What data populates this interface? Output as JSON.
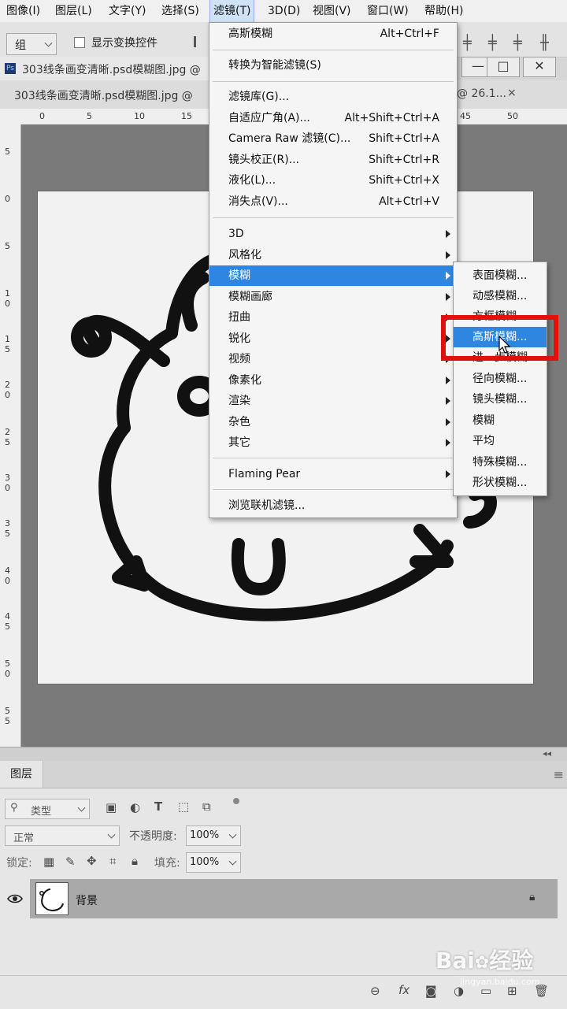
{
  "menubar": {
    "items": [
      "图像(I)",
      "图层(L)",
      "文字(Y)",
      "选择(S)",
      "滤镜(T)",
      "3D(D)",
      "视图(V)",
      "窗口(W)",
      "帮助(H)"
    ]
  },
  "options_bar": {
    "group_select": "组",
    "show_transform_label": "显示变换控件"
  },
  "doc_tabs": {
    "tab1": "303线条画变清晰.psd模糊图.jpg @",
    "tab2": "303线条画变清晰.psd模糊图.jpg @",
    "tab_right": "@ 26.1...",
    "close": "×"
  },
  "window_buttons": [
    "—",
    "□",
    "✕"
  ],
  "rulers": {
    "top": [
      "0",
      "5",
      "10",
      "15",
      "45",
      "50"
    ],
    "left": [
      "5",
      "0",
      "5",
      "1 0",
      "1 5",
      "2 0",
      "2 5",
      "3 0",
      "3 5",
      "4 0",
      "4 5",
      "5 0",
      "5 5"
    ]
  },
  "filter_menu": {
    "items": [
      {
        "label": "高斯模糊",
        "shortcut": "Alt+Ctrl+F"
      },
      {
        "label": "转换为智能滤镜(S)",
        "shortcut": ""
      },
      {
        "label": "滤镜库(G)...",
        "shortcut": ""
      },
      {
        "label": "自适应广角(A)...",
        "shortcut": "Alt+Shift+Ctrl+A"
      },
      {
        "label": "Camera Raw 滤镜(C)...",
        "shortcut": "Shift+Ctrl+A"
      },
      {
        "label": "镜头校正(R)...",
        "shortcut": "Shift+Ctrl+R"
      },
      {
        "label": "液化(L)...",
        "shortcut": "Shift+Ctrl+X"
      },
      {
        "label": "消失点(V)...",
        "shortcut": "Alt+Ctrl+V"
      },
      {
        "label": "3D"
      },
      {
        "label": "风格化"
      },
      {
        "label": "模糊"
      },
      {
        "label": "模糊画廊"
      },
      {
        "label": "扭曲"
      },
      {
        "label": "锐化"
      },
      {
        "label": "视频"
      },
      {
        "label": "像素化"
      },
      {
        "label": "渲染"
      },
      {
        "label": "杂色"
      },
      {
        "label": "其它"
      },
      {
        "label": "Flaming Pear"
      },
      {
        "label": "浏览联机滤镜..."
      }
    ]
  },
  "blur_submenu": {
    "items": [
      "表面模糊...",
      "动感模糊...",
      "方框模糊...",
      "高斯模糊...",
      "进一步模糊",
      "径向模糊...",
      "镜头模糊...",
      "模糊",
      "平均",
      "特殊模糊...",
      "形状模糊..."
    ]
  },
  "layers_panel": {
    "tab": "图层",
    "filter_kind": "类型",
    "blend_mode": "正常",
    "opacity_label": "不透明度:",
    "opacity_value": "100%",
    "lock_label": "锁定:",
    "fill_label": "填充:",
    "fill_value": "100%",
    "layer_name": "背景"
  },
  "watermark": {
    "text": "Bai",
    "text2": "经验",
    "sub": "jingyan.baidu.com"
  },
  "colors": {
    "highlight": "#2f86e0",
    "annotation": "#e01010"
  }
}
